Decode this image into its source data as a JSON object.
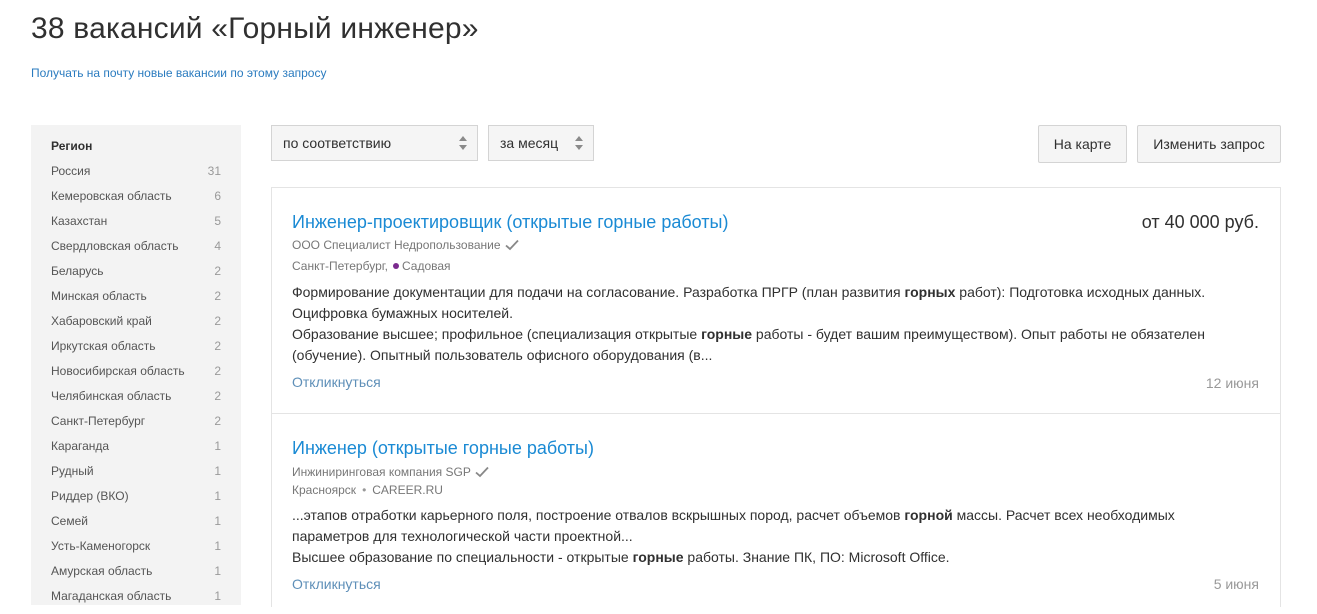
{
  "header": {
    "title": "38 вакансий «Горный инженер»",
    "subscribe_link": "Получать на почту новые вакансии по этому запросу"
  },
  "sidebar": {
    "title": "Регион",
    "regions": [
      {
        "name": "Россия",
        "count": "31"
      },
      {
        "name": "Кемеровская область",
        "count": "6"
      },
      {
        "name": "Казахстан",
        "count": "5"
      },
      {
        "name": "Свердловская область",
        "count": "4"
      },
      {
        "name": "Беларусь",
        "count": "2"
      },
      {
        "name": "Минская область",
        "count": "2"
      },
      {
        "name": "Хабаровский край",
        "count": "2"
      },
      {
        "name": "Иркутская область",
        "count": "2"
      },
      {
        "name": "Новосибирская область",
        "count": "2"
      },
      {
        "name": "Челябинская область",
        "count": "2"
      },
      {
        "name": "Санкт-Петербург",
        "count": "2"
      },
      {
        "name": "Караганда",
        "count": "1"
      },
      {
        "name": "Рудный",
        "count": "1"
      },
      {
        "name": "Риддер (ВКО)",
        "count": "1"
      },
      {
        "name": "Семей",
        "count": "1"
      },
      {
        "name": "Усть-Каменогорск",
        "count": "1"
      },
      {
        "name": "Амурская область",
        "count": "1"
      },
      {
        "name": "Магаданская область",
        "count": "1"
      }
    ]
  },
  "toolbar": {
    "sort_value": "по соответствию",
    "period_value": "за месяц",
    "map_button": "На карте",
    "edit_button": "Изменить запрос"
  },
  "vacancies": [
    {
      "title": "Инженер-проектировщик (открытые горные работы)",
      "salary": "от 40 000 руб.",
      "company": "ООО Специалист Недропользование",
      "city": "Санкт-Петербург,",
      "metro": "Садовая",
      "desc_line1_a": "Формирование документации для подачи на согласование. Разработка ПРГР (план развития ",
      "desc_line1_b": "горных",
      "desc_line1_c": " работ): Подготовка исходных данных. Оцифровка бумажных носителей.",
      "desc_line2_a": "Образование высшее; профильное (специализация открытые ",
      "desc_line2_b": "горные",
      "desc_line2_c": " работы - будет вашим преимуществом). Опыт работы не обязателен (обучение). Опытный пользователь офисного оборудования (в...",
      "respond": "Откликнуться",
      "date": "12 июня"
    },
    {
      "title": "Инженер (открытые горные работы)",
      "company": "Инжиниринговая компания SGP",
      "city": "Красноярск",
      "source": "CAREER.RU",
      "desc_line1_a": "...этапов отработки карьерного поля, построение отвалов вскрышных пород, расчет объемов ",
      "desc_line1_b": "горной",
      "desc_line1_c": " массы. Расчет всех необходимых параметров для технологической части проектной...",
      "desc_line2_a": "Высшее образование по специальности - открытые ",
      "desc_line2_b": "горные",
      "desc_line2_c": " работы. Знание ПК, ПО: Microsoft Office.",
      "respond": "Откликнуться",
      "date": "5 июня"
    }
  ],
  "colors": {
    "link": "#1a8ad4",
    "respond_link": "#5e8fb8",
    "metro_line": "#7b2a8e",
    "sidebar_bg": "#f3f3f3"
  }
}
